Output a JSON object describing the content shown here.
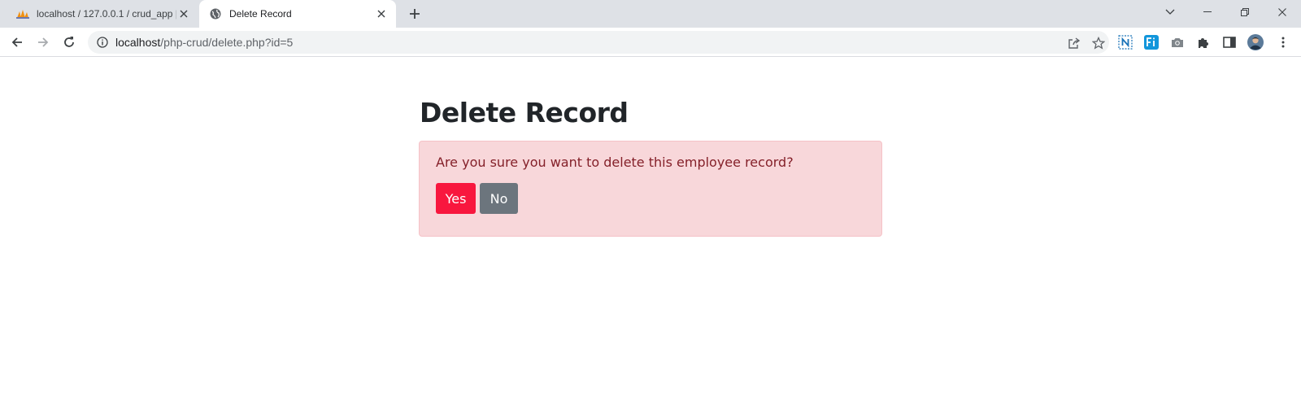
{
  "tabs": [
    {
      "title": "localhost / 127.0.0.1 / crud_app |",
      "favicon": "phpmyadmin-icon"
    },
    {
      "title": "Delete Record",
      "favicon": "globe-icon"
    }
  ],
  "address_bar": {
    "host": "localhost",
    "path": "/php-crud/delete.php?id=5"
  },
  "page": {
    "heading": "Delete Record",
    "alert_text": "Are you sure you want to delete this employee record?",
    "yes_label": "Yes",
    "no_label": "No"
  },
  "colors": {
    "alert_bg": "#f8d7da",
    "alert_text": "#842029",
    "yes_button": "#f8173e",
    "no_button": "#6c757d"
  }
}
